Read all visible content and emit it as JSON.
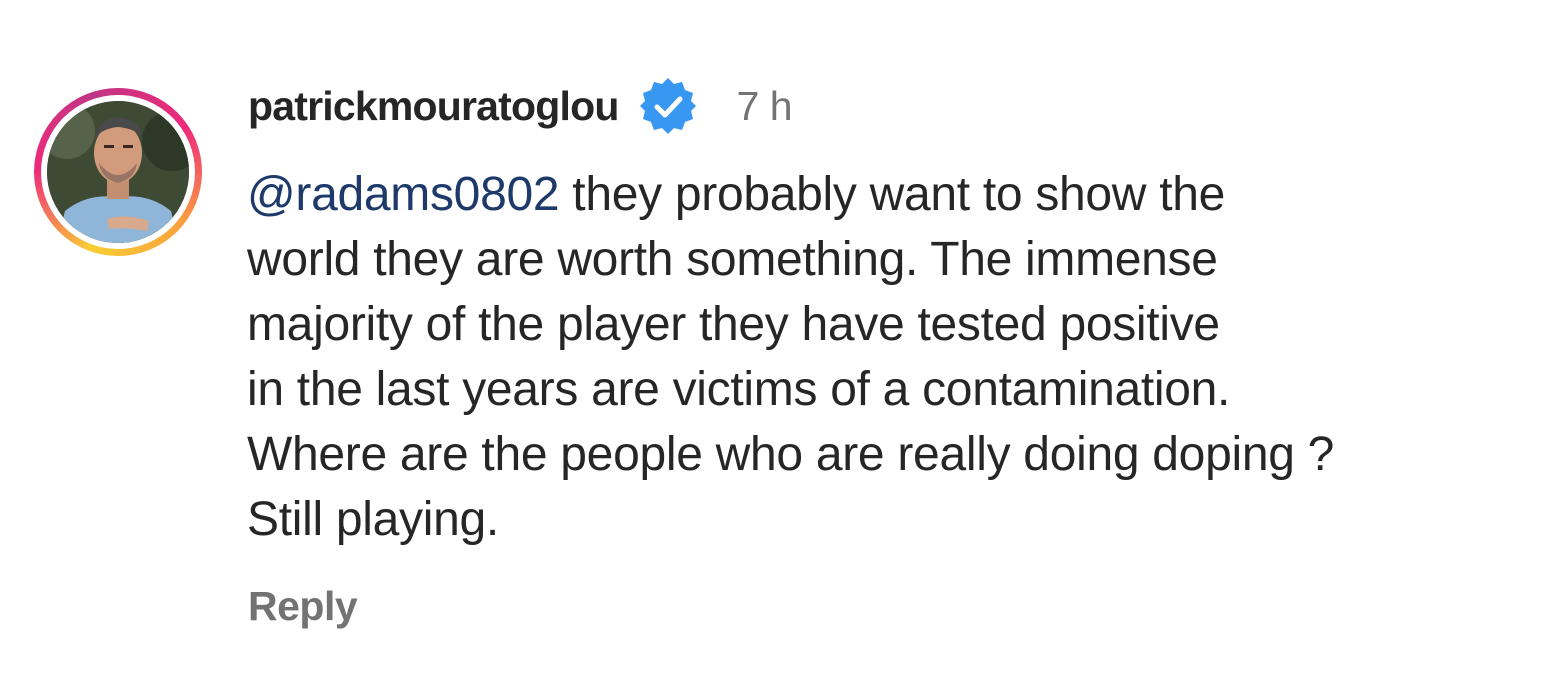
{
  "comment": {
    "username": "patrickmouratoglou",
    "verified_icon": "verified-badge-icon",
    "time": "7 h",
    "mention": "@radams0802",
    "text_lines": [
      " they probably want to show the",
      "world they are worth something. The immense",
      "majority of the player they have tested positive",
      "in the last years are victims of a contamination.",
      "Where are the people who are really doing doping ?",
      "Still playing."
    ],
    "reply_label": "Reply"
  },
  "colors": {
    "verified": "#3897f0",
    "mention": "#1e3a6b",
    "secondary_text": "#737373",
    "primary_text": "#262626"
  }
}
